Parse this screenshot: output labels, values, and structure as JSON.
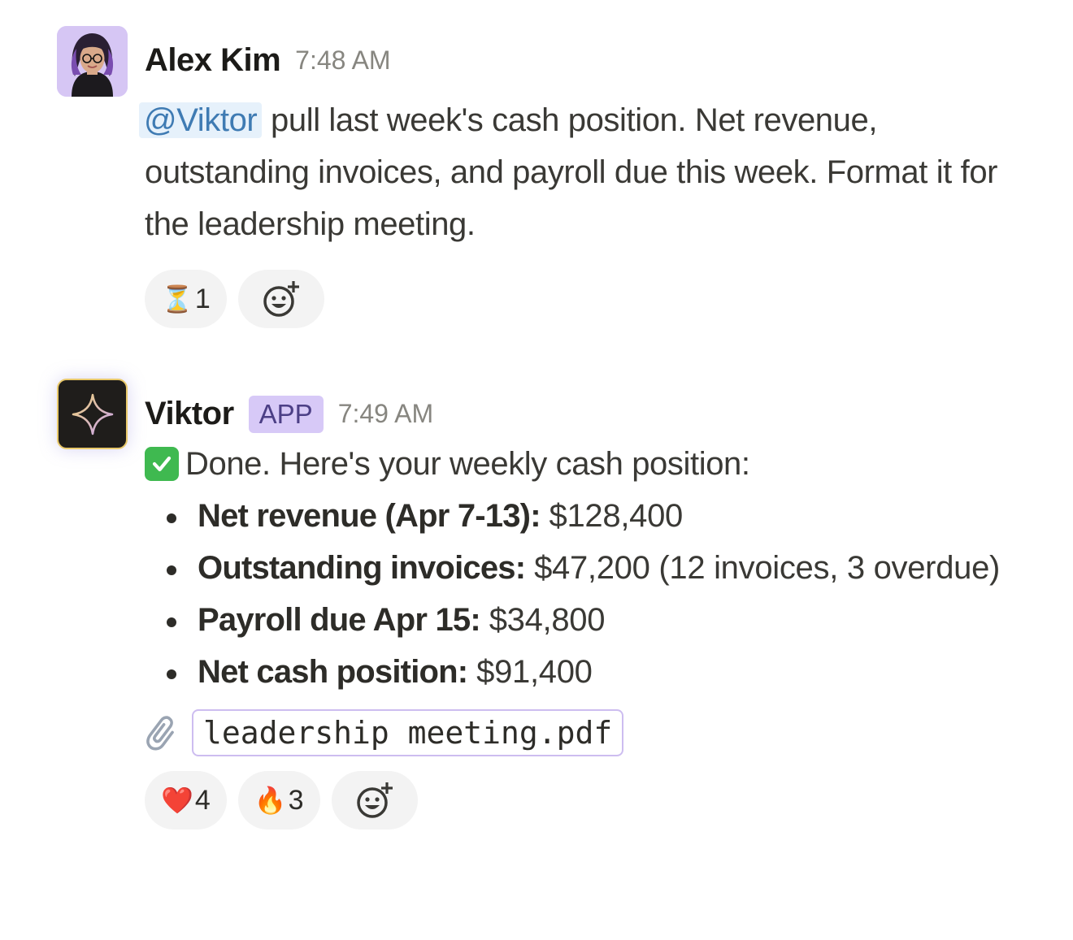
{
  "messages": [
    {
      "sender": "Alex Kim",
      "time": "7:48 AM",
      "mention": "@Viktor",
      "text": " pull last week's cash position. Net revenue, outstanding invoices, and payroll due this week. Format it for the leadership meeting.",
      "reactions": [
        {
          "emoji": "⏳",
          "icon": "hourglass-icon",
          "count": "1"
        }
      ]
    },
    {
      "sender": "Viktor",
      "badge": "APP",
      "time": "7:49 AM",
      "intro": "Done. Here's your weekly cash position:",
      "bullets": [
        {
          "label": "Net revenue (Apr 7-13):",
          "value": " $128,400"
        },
        {
          "label": "Outstanding invoices:",
          "value": " $47,200 (12 invoices, 3 overdue)"
        },
        {
          "label": "Payroll due Apr 15:",
          "value": " $34,800"
        },
        {
          "label": "Net cash position:",
          "value": " $91,400"
        }
      ],
      "attachment": "leadership meeting.pdf",
      "reactions": [
        {
          "emoji": "❤️",
          "icon": "heart-icon",
          "count": "4"
        },
        {
          "emoji": "🔥",
          "icon": "fire-icon",
          "count": "3"
        }
      ]
    }
  ],
  "colors": {
    "mention_bg": "#e6f1fb",
    "mention_text": "#3f7bb3",
    "app_badge_bg": "#d7c9f7",
    "check_green": "#3fb950",
    "attachment_border": "#cdbdf0"
  }
}
